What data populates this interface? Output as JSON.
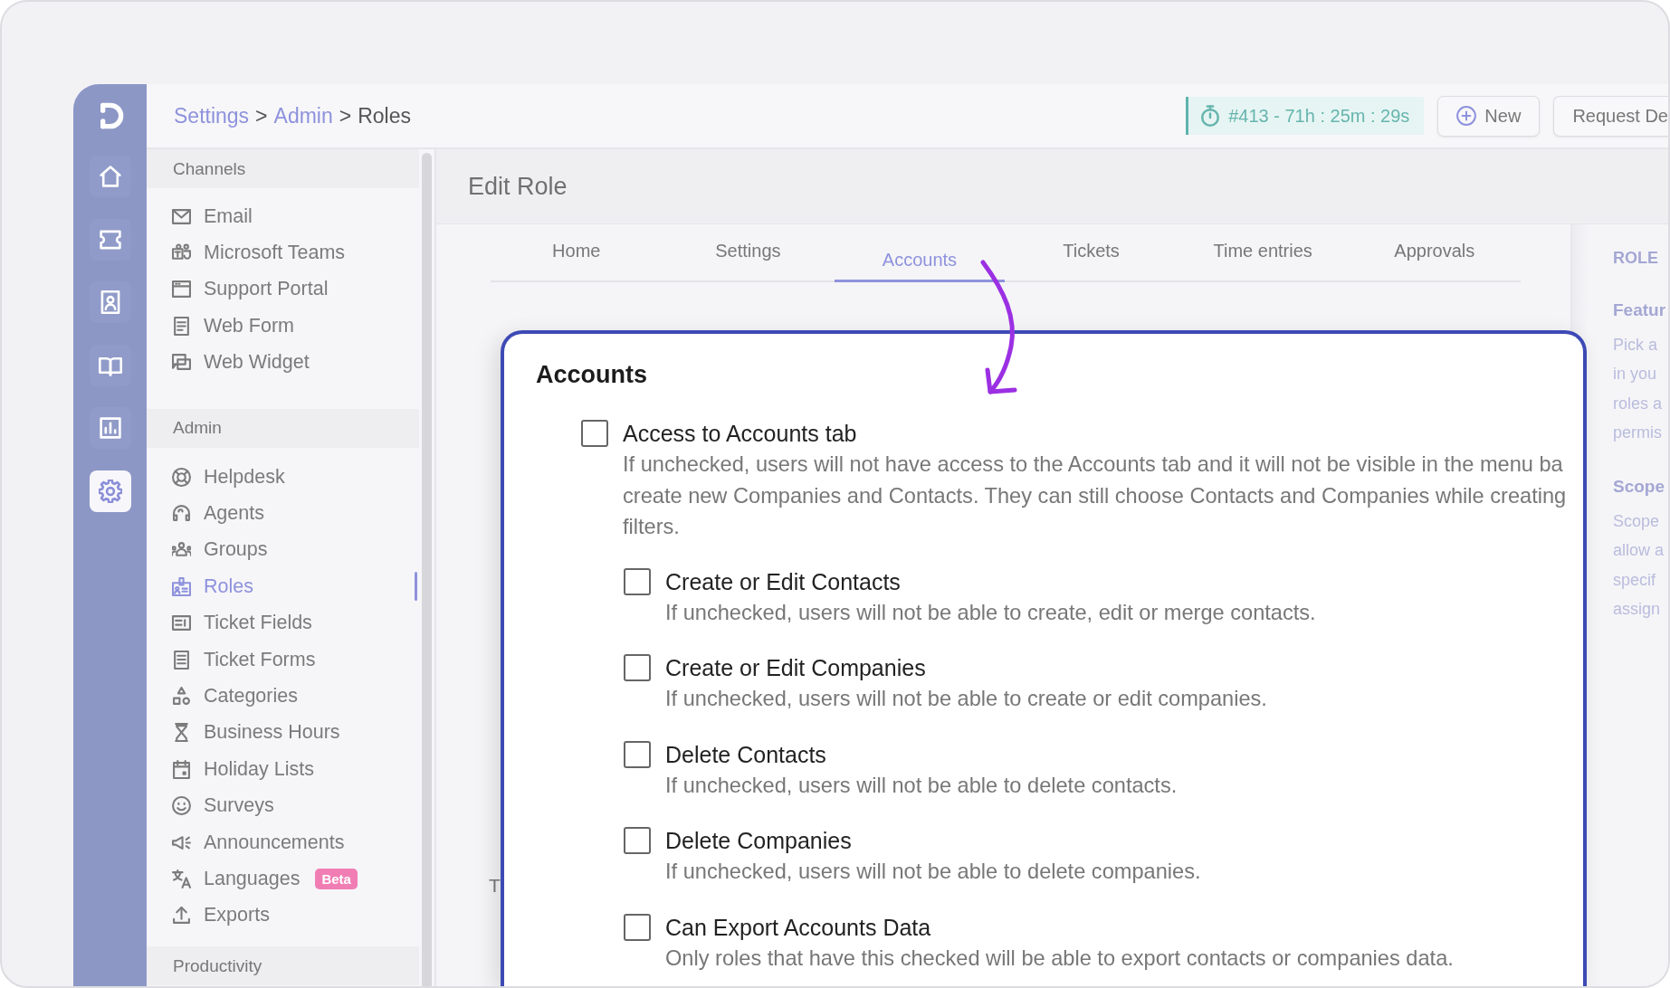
{
  "rail": [
    {
      "selected": false
    },
    {
      "selected": false
    },
    {
      "selected": false
    },
    {
      "selected": false
    },
    {
      "selected": false
    },
    {
      "selected": true
    }
  ],
  "breadcrumb": [
    {
      "label": "Settings",
      "kind": "link"
    },
    {
      "label": ">",
      "kind": "separator"
    },
    {
      "label": "Admin",
      "kind": "link"
    },
    {
      "label": ">",
      "kind": "separator"
    },
    {
      "label": "Roles",
      "kind": "current"
    }
  ],
  "timer": {
    "label": "#413 - 71h : 25m : 29s"
  },
  "header_buttons": [
    {
      "label": "New",
      "kind": "icon"
    },
    {
      "label": "Request De",
      "kind": "text"
    }
  ],
  "sidebar": {
    "sections": [
      {
        "title": "Channels",
        "items": [
          {
            "label": "Email",
            "selected": false
          },
          {
            "label": "Microsoft Teams",
            "selected": false
          },
          {
            "label": "Support Portal",
            "selected": false
          },
          {
            "label": "Web Form",
            "selected": false
          },
          {
            "label": "Web Widget",
            "selected": false
          }
        ]
      },
      {
        "title": "Admin",
        "items": [
          {
            "label": "Helpdesk",
            "selected": false
          },
          {
            "label": "Agents",
            "selected": false
          },
          {
            "label": "Groups",
            "selected": false
          },
          {
            "label": "Roles",
            "selected": true
          },
          {
            "label": "Ticket Fields",
            "selected": false
          },
          {
            "label": "Ticket Forms",
            "selected": false
          },
          {
            "label": "Categories",
            "selected": false
          },
          {
            "label": "Business Hours",
            "selected": false
          },
          {
            "label": "Holiday Lists",
            "selected": false
          },
          {
            "label": "Surveys",
            "selected": false
          },
          {
            "label": "Announcements",
            "selected": false
          },
          {
            "label": "Languages",
            "selected": false,
            "badge": "Beta"
          },
          {
            "label": "Exports",
            "selected": false
          }
        ]
      },
      {
        "title": "Productivity"
      }
    ]
  },
  "page": {
    "title": "Edit Role",
    "tabs": [
      {
        "label": "Home",
        "selected": false
      },
      {
        "label": "Settings",
        "selected": false
      },
      {
        "label": "Accounts",
        "selected": true
      },
      {
        "label": "Tickets",
        "selected": false
      },
      {
        "label": "Time entries",
        "selected": false
      },
      {
        "label": "Approvals",
        "selected": false
      }
    ],
    "section_title": "T"
  },
  "callout": {
    "title": "Accounts",
    "permissions": [
      {
        "label": "Access to Accounts tab",
        "description": "If unchecked, users will not have access to the Accounts tab and it will not be visible in the menu ba\ncreate new Companies and Contacts. They can still choose Contacts and Companies while creating\nfilters.",
        "checked": false,
        "children": [
          {
            "label": "Create or Edit Contacts",
            "description": "If unchecked, users will not be able to create, edit or merge contacts.",
            "checked": false
          },
          {
            "label": "Create or Edit Companies",
            "description": "If unchecked, users will not be able to create or edit companies.",
            "checked": false
          },
          {
            "label": "Delete Contacts",
            "description": "If unchecked, users will not be able to delete contacts.",
            "checked": false
          },
          {
            "label": "Delete Companies",
            "description": "If unchecked, users will not be able to delete companies.",
            "checked": false
          },
          {
            "label": "Can Export Accounts Data",
            "description": "Only roles that have this checked will be able to export contacts or companies data.",
            "checked": false
          }
        ]
      }
    ]
  },
  "side_panel": {
    "heading": "ROLE",
    "sections": [
      {
        "title": "Featur",
        "text": "Pick a\nin you\nroles a\npermis"
      },
      {
        "title": "Scope",
        "text": "Scope\nallow a\nspecif\nassign"
      }
    ]
  }
}
